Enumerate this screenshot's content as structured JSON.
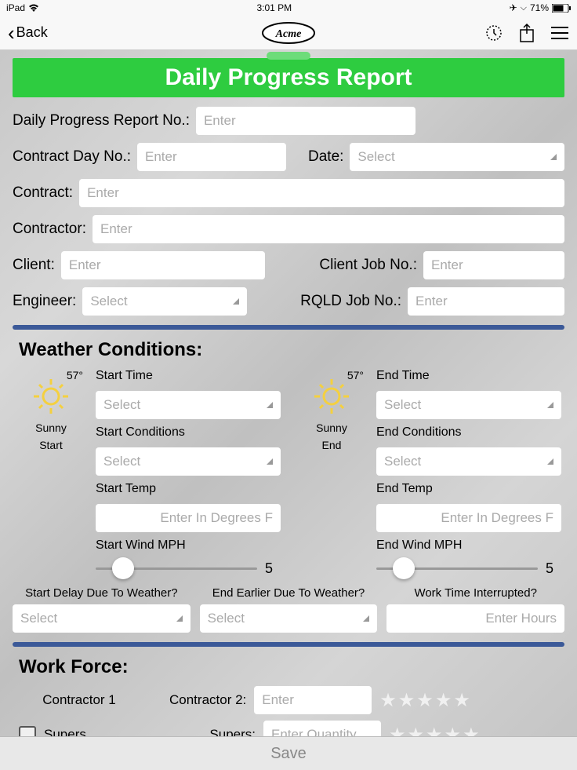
{
  "status": {
    "device": "iPad",
    "time": "3:01 PM",
    "battery": "71%"
  },
  "nav": {
    "back": "Back",
    "logo": "Acme"
  },
  "banner": "Daily Progress Report",
  "header": {
    "reportNo": {
      "label": "Daily Progress Report No.:",
      "placeholder": "Enter"
    },
    "contractDay": {
      "label": "Contract Day No.:",
      "placeholder": "Enter"
    },
    "date": {
      "label": "Date:",
      "placeholder": "Select"
    },
    "contract": {
      "label": "Contract:",
      "placeholder": "Enter"
    },
    "contractor": {
      "label": "Contractor:",
      "placeholder": "Enter"
    },
    "client": {
      "label": "Client:",
      "placeholder": "Enter"
    },
    "clientJobNo": {
      "label": "Client Job No.:",
      "placeholder": "Enter"
    },
    "engineer": {
      "label": "Engineer:",
      "placeholder": "Select"
    },
    "rqldJobNo": {
      "label": "RQLD Job No.:",
      "placeholder": "Enter"
    }
  },
  "weather": {
    "section": "Weather Conditions:",
    "start": {
      "temp": "57°",
      "condition": "Sunny",
      "phase": "Start",
      "timeLabel": "Start Time",
      "timePlaceholder": "Select",
      "condLabel": "Start Conditions",
      "condPlaceholder": "Select",
      "tempLabel": "Start Temp",
      "tempPlaceholder": "Enter In Degrees F",
      "windLabel": "Start Wind MPH",
      "windValue": "5"
    },
    "end": {
      "temp": "57°",
      "condition": "Sunny",
      "phase": "End",
      "timeLabel": "End Time",
      "timePlaceholder": "Select",
      "condLabel": "End Conditions",
      "condPlaceholder": "Select",
      "tempLabel": "End Temp",
      "tempPlaceholder": "Enter In Degrees F",
      "windLabel": "End Wind MPH",
      "windValue": "5"
    },
    "questions": {
      "startDelay": {
        "label": "Start Delay Due To Weather?",
        "placeholder": "Select"
      },
      "endEarlier": {
        "label": "End Earlier Due To Weather?",
        "placeholder": "Select"
      },
      "interrupted": {
        "label": "Work Time Interrupted?",
        "placeholder": "Enter Hours"
      }
    }
  },
  "workforce": {
    "section": "Work Force:",
    "contractor1": "Contractor 1",
    "contractor2": {
      "label": "Contractor 2:",
      "placeholder": "Enter"
    },
    "supers1": "Supers",
    "supers2": {
      "label": "Supers:",
      "placeholder": "Enter Quantity"
    }
  },
  "save": "Save"
}
